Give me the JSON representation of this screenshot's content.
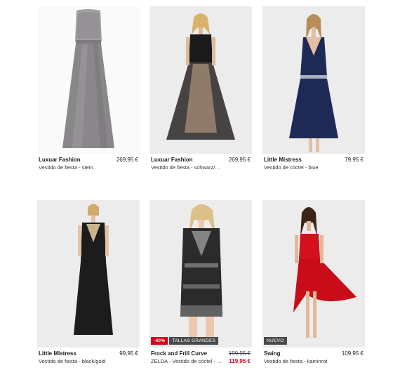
{
  "products": [
    {
      "brand": "Luxuar Fashion",
      "description": "Vestido de fiesta - stein",
      "price": "269,95 €"
    },
    {
      "brand": "Luxuar Fashion",
      "description": "Vestido de fiesta - schwarz/nude",
      "price": "269,95 €"
    },
    {
      "brand": "Little Mistress",
      "description": "Vestido de cóctel - blue",
      "price": "79,95 €"
    },
    {
      "brand": "Little Mistress",
      "description": "Vestido de fiesta - black/gold",
      "price": "99,95 €"
    },
    {
      "brand": "Frock and Frill Curve",
      "description": "ZELDA - Vestido de cóctel - bl...",
      "price_old": "199,95 €",
      "price_new": "119,95 €",
      "badges": {
        "discount": "-40%",
        "size": "TALLAS GRANDES"
      }
    },
    {
      "brand": "Swing",
      "description": "Vestido de fiesta - kaminrot",
      "price": "109,95 €",
      "badges": {
        "new": "NUEVO"
      }
    }
  ],
  "colors": {
    "background": "#ffffff",
    "image_bg": "#ebebeb",
    "sale_price": "#d0021b",
    "discount_badge": "#d0021b",
    "dress_grey": "#8a8a8e",
    "dress_black": "#1c1c1c",
    "dress_navy": "#1e2a55",
    "dress_red": "#d3101c"
  }
}
